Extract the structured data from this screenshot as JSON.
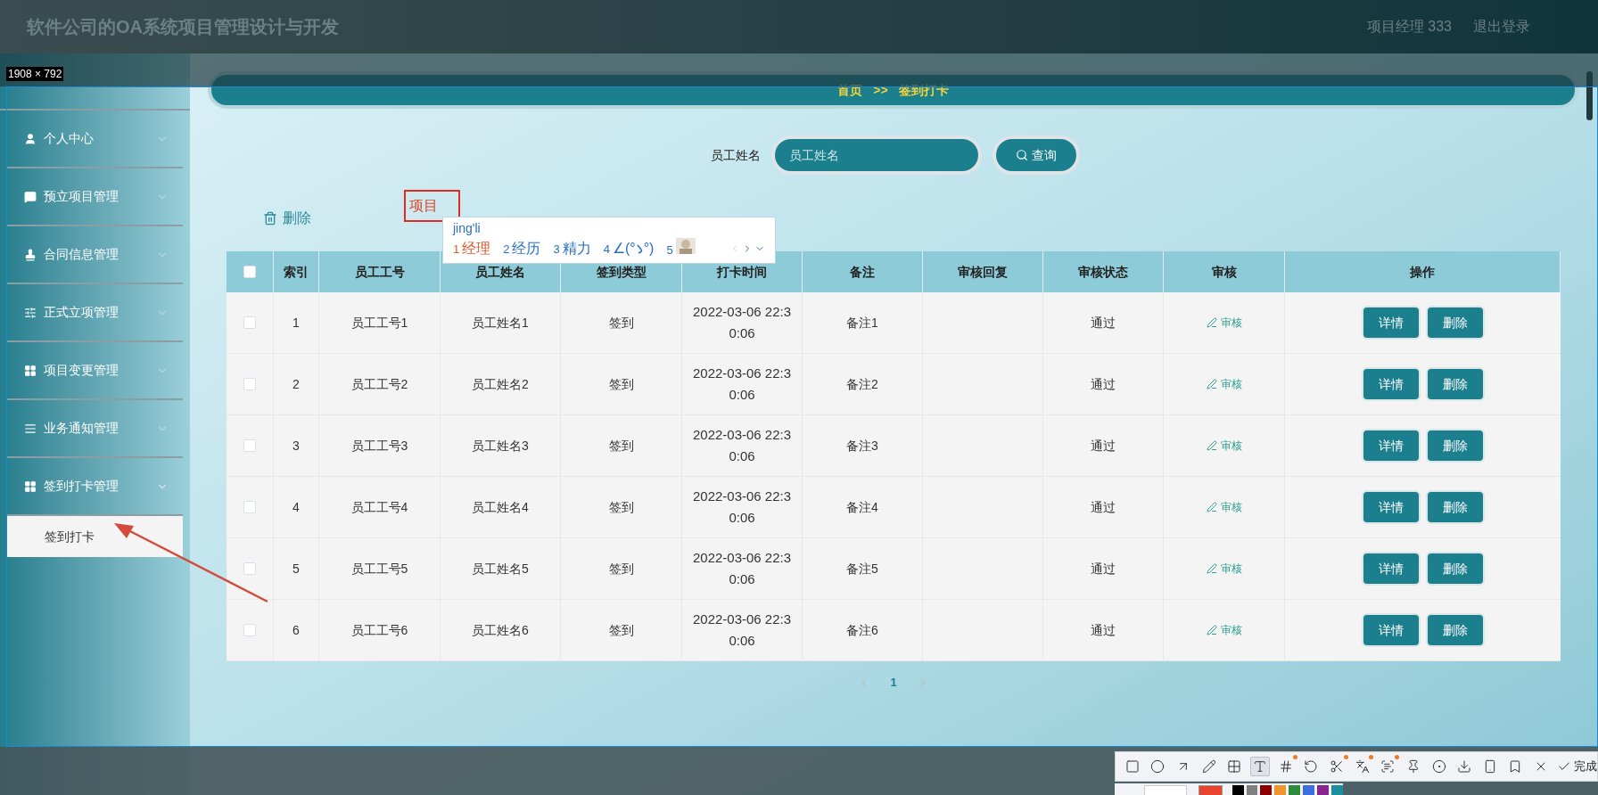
{
  "header": {
    "title": "软件公司的OA系统项目管理设计与开发",
    "user": "项目经理 333",
    "logout": "退出登录"
  },
  "capture": {
    "size_label": "1908 × 792"
  },
  "sidebar": {
    "items": [
      {
        "label": "个人中心",
        "kind": "user",
        "expanded": false
      },
      {
        "label": "预立项目管理",
        "kind": "chat",
        "expanded": false
      },
      {
        "label": "合同信息管理",
        "kind": "stamp",
        "expanded": false
      },
      {
        "label": "正式立项管理",
        "kind": "sliders",
        "expanded": false
      },
      {
        "label": "项目变更管理",
        "kind": "grid",
        "expanded": false
      },
      {
        "label": "业务通知管理",
        "kind": "list",
        "expanded": false
      },
      {
        "label": "签到打卡管理",
        "kind": "grid",
        "expanded": true,
        "children": [
          {
            "label": "签到打卡",
            "selected": true
          }
        ]
      }
    ]
  },
  "breadcrumb": [
    "首页",
    ">>",
    "签到打卡"
  ],
  "search": {
    "label": "员工姓名",
    "placeholder": "员工姓名",
    "button": "查询"
  },
  "actions": {
    "delete": "删除"
  },
  "ime": {
    "composition": "项目",
    "pinyin": "jing'li",
    "candidates": [
      {
        "kind": "text",
        "number": "1",
        "text": "经理",
        "selected": true
      },
      {
        "kind": "text",
        "number": "2",
        "text": "经历",
        "selected": false
      },
      {
        "kind": "text",
        "number": "3",
        "text": "精力",
        "selected": false
      },
      {
        "kind": "emoticon",
        "number": "4",
        "text_before": "∠(°",
        "text_after": "°)",
        "selected": false
      },
      {
        "kind": "picture",
        "number": "5",
        "selected": false
      }
    ]
  },
  "table": {
    "select_all": {
      "checked": false
    },
    "columns": [
      "索引",
      "员工工号",
      "员工姓名",
      "签到类型",
      "打卡时间",
      "备注",
      "审核回复",
      "审核状态",
      "审核",
      "操作"
    ],
    "rows": [
      {
        "checked": false,
        "index": "1",
        "employee_no": "员工工号1",
        "employee_name": "员工姓名1",
        "type": "签到",
        "time": "2022-03-06 22:30:06",
        "remark": "备注1",
        "status": "通过",
        "review": "审核",
        "buttons": [
          "详情",
          "删除"
        ]
      },
      {
        "checked": false,
        "index": "2",
        "employee_no": "员工工号2",
        "employee_name": "员工姓名2",
        "type": "签到",
        "time": "2022-03-06 22:30:06",
        "remark": "备注2",
        "status": "通过",
        "review": "审核",
        "buttons": [
          "详情",
          "删除"
        ]
      },
      {
        "checked": false,
        "index": "3",
        "employee_no": "员工工号3",
        "employee_name": "员工姓名3",
        "type": "签到",
        "time": "2022-03-06 22:30:06",
        "remark": "备注3",
        "status": "通过",
        "review": "审核",
        "buttons": [
          "详情",
          "删除"
        ]
      },
      {
        "checked": false,
        "index": "4",
        "employee_no": "员工工号4",
        "employee_name": "员工姓名4",
        "type": "签到",
        "time": "2022-03-06 22:30:06",
        "remark": "备注4",
        "status": "通过",
        "review": "审核",
        "buttons": [
          "详情",
          "删除"
        ]
      },
      {
        "checked": false,
        "index": "5",
        "employee_no": "员工工号5",
        "employee_name": "员工姓名5",
        "type": "签到",
        "time": "2022-03-06 22:30:06",
        "remark": "备注5",
        "status": "通过",
        "review": "审核",
        "buttons": [
          "详情",
          "删除"
        ]
      },
      {
        "checked": false,
        "index": "6",
        "employee_no": "员工工号6",
        "employee_name": "员工姓名6",
        "type": "签到",
        "time": "2022-03-06 22:30:06",
        "remark": "备注6",
        "status": "通过",
        "review": "审核",
        "buttons": [
          "详情",
          "删除"
        ]
      }
    ]
  },
  "pagination": {
    "pages": [
      {
        "label": "1",
        "selected": true
      }
    ]
  },
  "capture_toolbar": {
    "tools": [
      {
        "kind": "rectangle",
        "selected": false,
        "dot": false
      },
      {
        "kind": "ellipse",
        "selected": false,
        "dot": false
      },
      {
        "kind": "arrow",
        "selected": false,
        "dot": false
      },
      {
        "kind": "pen",
        "selected": false,
        "dot": false
      },
      {
        "kind": "mosaic",
        "selected": false,
        "dot": false
      },
      {
        "kind": "text",
        "selected": true,
        "dot": false
      },
      {
        "kind": "number",
        "selected": false,
        "dot": true
      },
      {
        "kind": "undo",
        "selected": false,
        "dot": false
      },
      {
        "kind": "cut",
        "selected": false,
        "dot": true
      },
      {
        "kind": "translate",
        "selected": false,
        "dot": true
      },
      {
        "kind": "ocr",
        "selected": false,
        "dot": true
      },
      {
        "kind": "pin",
        "selected": false,
        "dot": false
      },
      {
        "kind": "record",
        "selected": false,
        "dot": false
      },
      {
        "kind": "save",
        "selected": false,
        "dot": false
      },
      {
        "kind": "phone",
        "selected": false,
        "dot": false
      },
      {
        "kind": "bookmark",
        "selected": false,
        "dot": false
      },
      {
        "kind": "close",
        "selected": false,
        "dot": false
      }
    ],
    "done": "完成",
    "palette": [
      {
        "color": "#e8442e",
        "selected": true
      },
      {
        "color": "#000000",
        "selected": false
      },
      {
        "color": "#808080",
        "selected": false
      },
      {
        "color": "#8b0000",
        "selected": false
      },
      {
        "color": "#f0952e",
        "selected": false
      },
      {
        "color": "#2e8b3e",
        "selected": false
      },
      {
        "color": "#3b6fe0",
        "selected": false
      },
      {
        "color": "#8b2391",
        "selected": false
      },
      {
        "color": "#1a8fa0",
        "selected": false
      }
    ]
  }
}
